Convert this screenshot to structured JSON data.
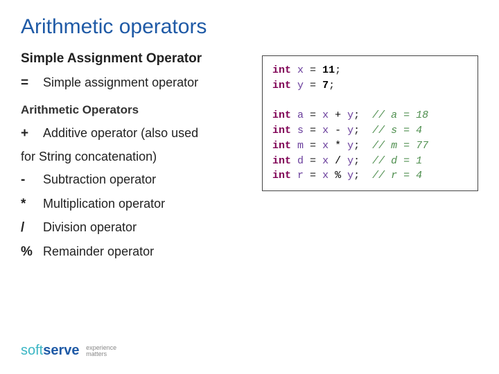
{
  "title": "Arithmetic operators",
  "section1": {
    "heading": "Simple Assignment Operator",
    "ops": [
      {
        "sym": "=",
        "desc": "Simple assignment operator"
      }
    ]
  },
  "section2": {
    "heading": "Arithmetic Operators",
    "plus": {
      "sym": "+",
      "desc": "Additive operator (also used"
    },
    "plus_cont": "for String concatenation)",
    "ops": [
      {
        "sym": "-",
        "desc": "Subtraction operator"
      },
      {
        "sym": "*",
        "desc": "Multiplication operator"
      },
      {
        "sym": "/",
        "desc": "Division operator"
      },
      {
        "sym": "%",
        "desc": "Remainder operator"
      }
    ]
  },
  "code": {
    "decl1": {
      "kw": "int",
      "name": "x",
      "val": "11"
    },
    "decl2": {
      "kw": "int",
      "name": "y",
      "val": "7"
    },
    "rows": [
      {
        "kw": "int",
        "name": "a",
        "lhs": "x",
        "op": "+",
        "rhs": "y",
        "cmt": "// a = 18"
      },
      {
        "kw": "int",
        "name": "s",
        "lhs": "x",
        "op": "-",
        "rhs": "y",
        "cmt": "// s = 4"
      },
      {
        "kw": "int",
        "name": "m",
        "lhs": "x",
        "op": "*",
        "rhs": "y",
        "cmt": "// m = 77"
      },
      {
        "kw": "int",
        "name": "d",
        "lhs": "x",
        "op": "/",
        "rhs": "y",
        "cmt": "// d = 1"
      },
      {
        "kw": "int",
        "name": "r",
        "lhs": "x",
        "op": "%",
        "rhs": "y",
        "cmt": "// r = 4"
      }
    ]
  },
  "logo": {
    "part1": "soft",
    "part2": "serve",
    "tag1": "experience",
    "tag2": "matters"
  }
}
